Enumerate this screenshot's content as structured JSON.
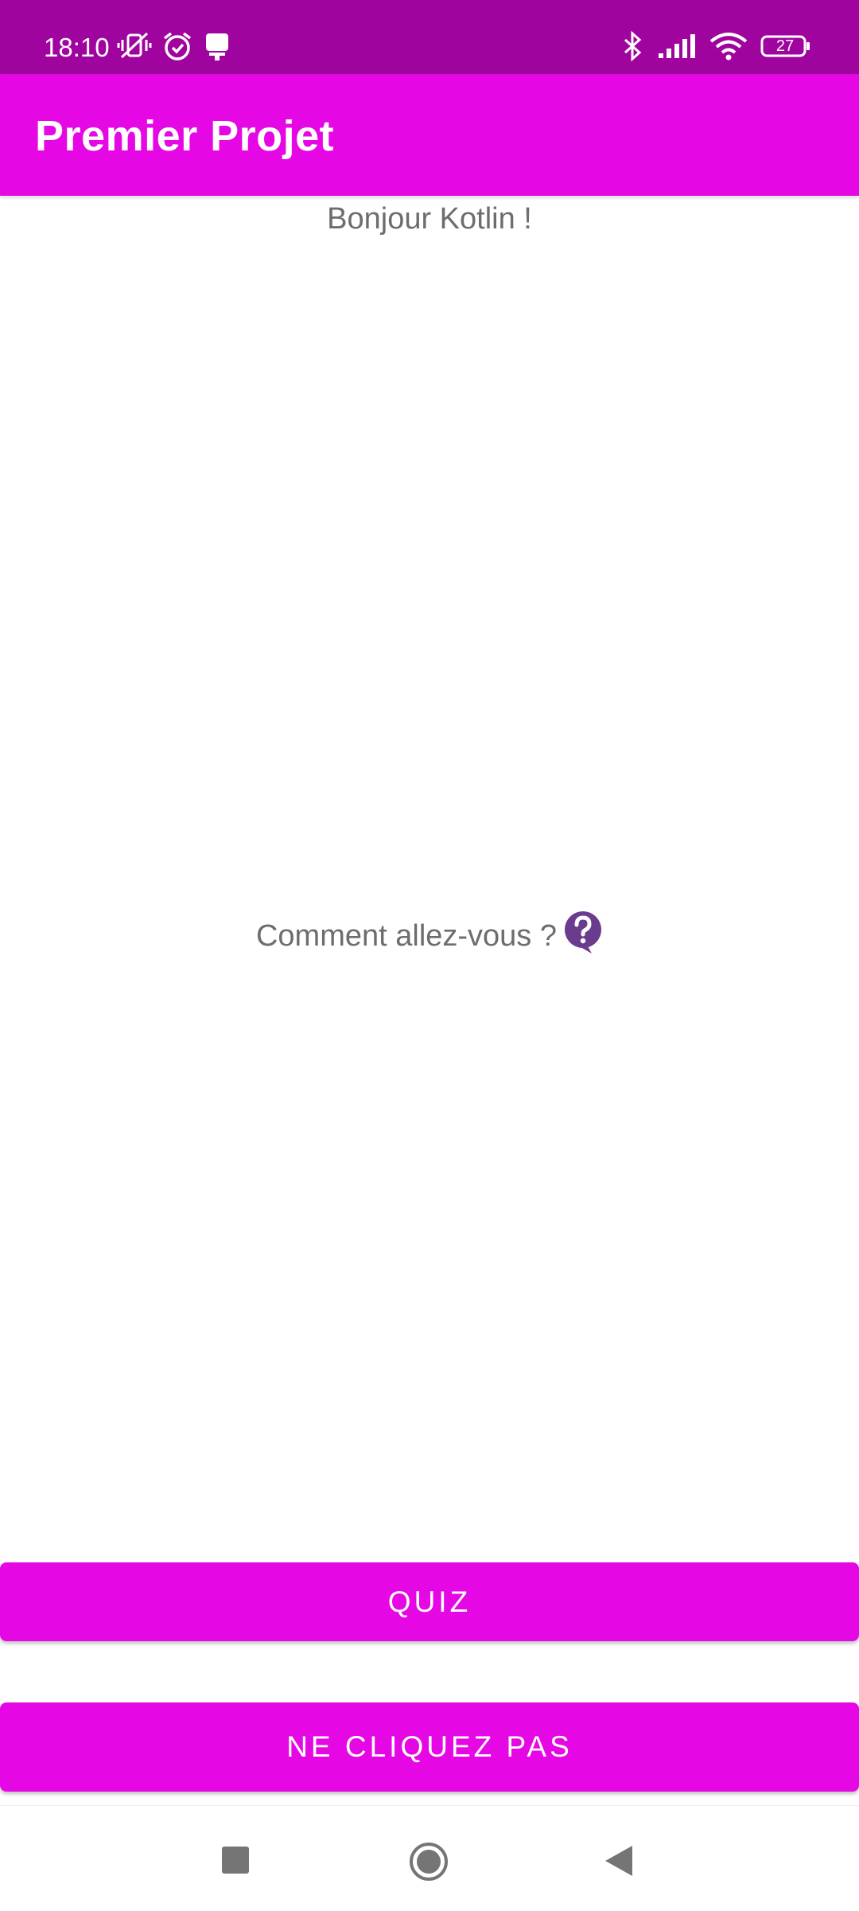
{
  "status_bar": {
    "time": "18:10",
    "left_icons": [
      "vibrate-off-icon",
      "alarm-icon",
      "notification-icon"
    ],
    "right_icons": [
      "bluetooth-icon",
      "signal-icon",
      "wifi-icon",
      "battery-icon"
    ],
    "battery_level": "27"
  },
  "app_bar": {
    "title": "Premier Projet"
  },
  "main": {
    "greeting": "Bonjour Kotlin !",
    "question": "Comment allez-vous ?",
    "question_icon": "question-bubble-icon"
  },
  "buttons": {
    "quiz_label": "QUIZ",
    "dont_click_label": "NE CLIQUEZ PAS"
  },
  "nav_bar": {
    "icons": [
      "recent-apps-icon",
      "home-icon",
      "back-icon"
    ]
  },
  "colors": {
    "status_bar": "#a0049f",
    "primary": "#e608e4",
    "text_secondary": "#6d6d6d",
    "icon_accent": "#6b3c8e"
  }
}
